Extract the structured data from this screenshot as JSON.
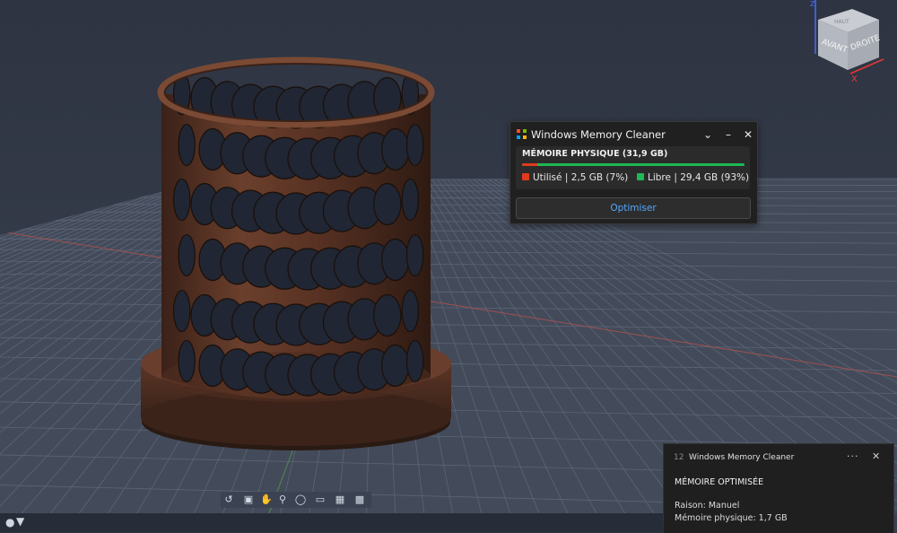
{
  "viewcube": {
    "top_label": "HAUT",
    "front_label": "AVANT",
    "right_label": "DROITE",
    "axis_x": "X",
    "axis_z": "Z"
  },
  "memory_cleaner": {
    "title": "Windows Memory Cleaner",
    "physical_memory_label": "MÉMOIRE PHYSIQUE (31,9 GB)",
    "used_text": "Utilisé | 2,5 GB (7%)",
    "free_text": "Libre | 29,4 GB (93%)",
    "used_fraction": 0.07,
    "optimize_label": "Optimiser",
    "colors": {
      "used": "#e03a1e",
      "free": "#1db954",
      "accent": "#55a8ff"
    },
    "icons": {
      "collapse": "chevron-down-icon",
      "minimize": "minimize-icon",
      "close": "close-icon"
    }
  },
  "notification": {
    "app_number": "12",
    "app_title": "Windows Memory Cleaner",
    "heading": "MÉMOIRE OPTIMISÉE",
    "reason": "Raison: Manuel",
    "physical": "Mémoire physique: 1,7 GB",
    "icons": {
      "more": "more-options-icon",
      "close": "close-icon"
    }
  },
  "nav_toolbar": {
    "tools": [
      "orbit-icon",
      "steering-wheel-icon",
      "pan-icon",
      "zoom-icon",
      "view-style-icon",
      "display-icon",
      "grid-icon",
      "layout-icon"
    ]
  }
}
